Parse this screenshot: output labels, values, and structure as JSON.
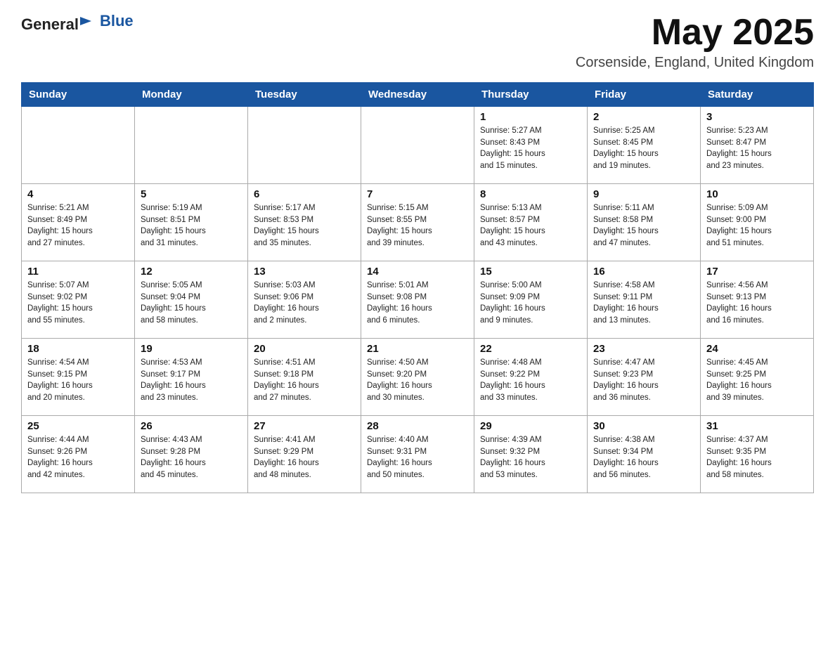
{
  "header": {
    "logo_general": "General",
    "logo_blue": "Blue",
    "month_title": "May 2025",
    "location": "Corsenside, England, United Kingdom"
  },
  "weekdays": [
    "Sunday",
    "Monday",
    "Tuesday",
    "Wednesday",
    "Thursday",
    "Friday",
    "Saturday"
  ],
  "weeks": [
    [
      {
        "day": "",
        "info": ""
      },
      {
        "day": "",
        "info": ""
      },
      {
        "day": "",
        "info": ""
      },
      {
        "day": "",
        "info": ""
      },
      {
        "day": "1",
        "info": "Sunrise: 5:27 AM\nSunset: 8:43 PM\nDaylight: 15 hours\nand 15 minutes."
      },
      {
        "day": "2",
        "info": "Sunrise: 5:25 AM\nSunset: 8:45 PM\nDaylight: 15 hours\nand 19 minutes."
      },
      {
        "day": "3",
        "info": "Sunrise: 5:23 AM\nSunset: 8:47 PM\nDaylight: 15 hours\nand 23 minutes."
      }
    ],
    [
      {
        "day": "4",
        "info": "Sunrise: 5:21 AM\nSunset: 8:49 PM\nDaylight: 15 hours\nand 27 minutes."
      },
      {
        "day": "5",
        "info": "Sunrise: 5:19 AM\nSunset: 8:51 PM\nDaylight: 15 hours\nand 31 minutes."
      },
      {
        "day": "6",
        "info": "Sunrise: 5:17 AM\nSunset: 8:53 PM\nDaylight: 15 hours\nand 35 minutes."
      },
      {
        "day": "7",
        "info": "Sunrise: 5:15 AM\nSunset: 8:55 PM\nDaylight: 15 hours\nand 39 minutes."
      },
      {
        "day": "8",
        "info": "Sunrise: 5:13 AM\nSunset: 8:57 PM\nDaylight: 15 hours\nand 43 minutes."
      },
      {
        "day": "9",
        "info": "Sunrise: 5:11 AM\nSunset: 8:58 PM\nDaylight: 15 hours\nand 47 minutes."
      },
      {
        "day": "10",
        "info": "Sunrise: 5:09 AM\nSunset: 9:00 PM\nDaylight: 15 hours\nand 51 minutes."
      }
    ],
    [
      {
        "day": "11",
        "info": "Sunrise: 5:07 AM\nSunset: 9:02 PM\nDaylight: 15 hours\nand 55 minutes."
      },
      {
        "day": "12",
        "info": "Sunrise: 5:05 AM\nSunset: 9:04 PM\nDaylight: 15 hours\nand 58 minutes."
      },
      {
        "day": "13",
        "info": "Sunrise: 5:03 AM\nSunset: 9:06 PM\nDaylight: 16 hours\nand 2 minutes."
      },
      {
        "day": "14",
        "info": "Sunrise: 5:01 AM\nSunset: 9:08 PM\nDaylight: 16 hours\nand 6 minutes."
      },
      {
        "day": "15",
        "info": "Sunrise: 5:00 AM\nSunset: 9:09 PM\nDaylight: 16 hours\nand 9 minutes."
      },
      {
        "day": "16",
        "info": "Sunrise: 4:58 AM\nSunset: 9:11 PM\nDaylight: 16 hours\nand 13 minutes."
      },
      {
        "day": "17",
        "info": "Sunrise: 4:56 AM\nSunset: 9:13 PM\nDaylight: 16 hours\nand 16 minutes."
      }
    ],
    [
      {
        "day": "18",
        "info": "Sunrise: 4:54 AM\nSunset: 9:15 PM\nDaylight: 16 hours\nand 20 minutes."
      },
      {
        "day": "19",
        "info": "Sunrise: 4:53 AM\nSunset: 9:17 PM\nDaylight: 16 hours\nand 23 minutes."
      },
      {
        "day": "20",
        "info": "Sunrise: 4:51 AM\nSunset: 9:18 PM\nDaylight: 16 hours\nand 27 minutes."
      },
      {
        "day": "21",
        "info": "Sunrise: 4:50 AM\nSunset: 9:20 PM\nDaylight: 16 hours\nand 30 minutes."
      },
      {
        "day": "22",
        "info": "Sunrise: 4:48 AM\nSunset: 9:22 PM\nDaylight: 16 hours\nand 33 minutes."
      },
      {
        "day": "23",
        "info": "Sunrise: 4:47 AM\nSunset: 9:23 PM\nDaylight: 16 hours\nand 36 minutes."
      },
      {
        "day": "24",
        "info": "Sunrise: 4:45 AM\nSunset: 9:25 PM\nDaylight: 16 hours\nand 39 minutes."
      }
    ],
    [
      {
        "day": "25",
        "info": "Sunrise: 4:44 AM\nSunset: 9:26 PM\nDaylight: 16 hours\nand 42 minutes."
      },
      {
        "day": "26",
        "info": "Sunrise: 4:43 AM\nSunset: 9:28 PM\nDaylight: 16 hours\nand 45 minutes."
      },
      {
        "day": "27",
        "info": "Sunrise: 4:41 AM\nSunset: 9:29 PM\nDaylight: 16 hours\nand 48 minutes."
      },
      {
        "day": "28",
        "info": "Sunrise: 4:40 AM\nSunset: 9:31 PM\nDaylight: 16 hours\nand 50 minutes."
      },
      {
        "day": "29",
        "info": "Sunrise: 4:39 AM\nSunset: 9:32 PM\nDaylight: 16 hours\nand 53 minutes."
      },
      {
        "day": "30",
        "info": "Sunrise: 4:38 AM\nSunset: 9:34 PM\nDaylight: 16 hours\nand 56 minutes."
      },
      {
        "day": "31",
        "info": "Sunrise: 4:37 AM\nSunset: 9:35 PM\nDaylight: 16 hours\nand 58 minutes."
      }
    ]
  ]
}
